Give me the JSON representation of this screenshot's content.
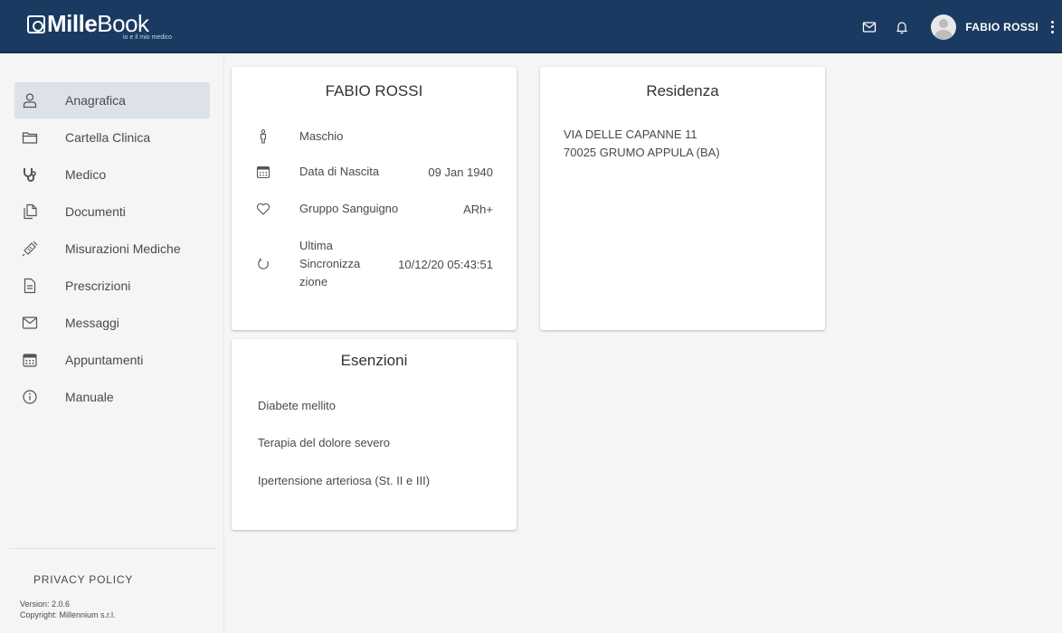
{
  "brand": {
    "name_bold": "Mille",
    "name_light": "Book",
    "tagline": "io e il mio medico"
  },
  "topbar": {
    "user_name": "FABIO ROSSI",
    "icons": [
      "mail-icon",
      "bell-icon",
      "avatar",
      "kebab-menu-icon"
    ]
  },
  "sidebar": {
    "items": [
      {
        "label": "Anagrafica",
        "icon": "person-icon",
        "active": true
      },
      {
        "label": "Cartella Clinica",
        "icon": "folder-icon"
      },
      {
        "label": "Medico",
        "icon": "stethoscope-icon"
      },
      {
        "label": "Documenti",
        "icon": "documents-icon"
      },
      {
        "label": "Misurazioni Mediche",
        "icon": "syringe-icon"
      },
      {
        "label": "Prescrizioni",
        "icon": "prescription-icon"
      },
      {
        "label": "Messaggi",
        "icon": "mail-icon"
      },
      {
        "label": "Appuntamenti",
        "icon": "calendar-icon"
      },
      {
        "label": "Manuale",
        "icon": "info-icon"
      }
    ],
    "privacy": "PRIVACY POLICY",
    "version": "Version: 2.0.6",
    "copyright": "Copyright: Millennium s.r.l."
  },
  "person_card": {
    "title": "FABIO ROSSI",
    "sex": "Maschio",
    "birth_label": "Data di Nascita",
    "birth_value": "09 Jan 1940",
    "blood_label": "Gruppo Sanguigno",
    "blood_value": "ARh+",
    "sync_label_1": "Ultima",
    "sync_label_2": "Sincronizza",
    "sync_label_3": "zione",
    "sync_value": "10/12/20 05:43:51"
  },
  "residence_card": {
    "title": "Residenza",
    "line1": "VIA DELLE CAPANNE 11",
    "line2": "70025 GRUMO APPULA (BA)"
  },
  "exemptions_card": {
    "title": "Esenzioni",
    "items": [
      "Diabete mellito",
      "Terapia del dolore severo",
      "Ipertensione arteriosa (St. II e III)"
    ]
  },
  "colors": {
    "topbar": "#1a3a61",
    "active_nav": "#dde2e8",
    "background": "#f5f5f5"
  }
}
